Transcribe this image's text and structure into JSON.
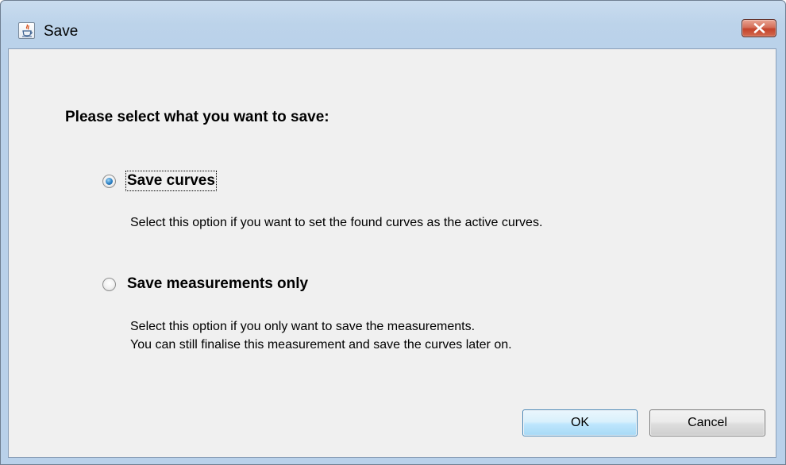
{
  "window": {
    "title": "Save"
  },
  "dialog": {
    "heading": "Please select what you want to save:",
    "options": [
      {
        "label": "Save curves",
        "checked": true,
        "description_lines": [
          "Select this option if you want to set the found curves as the active curves."
        ]
      },
      {
        "label": "Save measurements only",
        "checked": false,
        "description_lines": [
          "Select this option if you only want to save the measurements.",
          "You can still finalise this measurement and save the curves later on."
        ]
      }
    ]
  },
  "buttons": {
    "ok_label": "OK",
    "cancel_label": "Cancel"
  },
  "colors": {
    "titlebar": "#b9d1ea",
    "client_background": "#f0f0f0",
    "close_button": "#c4432b",
    "radio_selected": "#2a7fc3",
    "ok_button": "#bee6fd"
  },
  "icons": {
    "app": "java-cup-icon",
    "close": "close-icon"
  }
}
